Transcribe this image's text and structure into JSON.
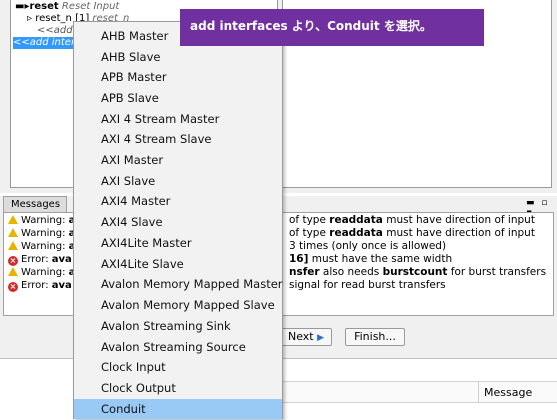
{
  "tree": {
    "rows": [
      {
        "name": "reset",
        "type": "Reset Input"
      },
      {
        "name": "reset_n [1]",
        "type": "reset_n"
      },
      {
        "label": "<<add s"
      },
      {
        "label": "<<add inter"
      }
    ]
  },
  "messages": {
    "tab_label": "Messages",
    "controls": "▬ ▫ ▪",
    "rows": [
      {
        "level": "warning",
        "level_label": "Warning:",
        "prefix": "av",
        "text_before": "of type ",
        "keyword": "readdata",
        "text_after": " must have direction of input"
      },
      {
        "level": "warning",
        "level_label": "Warning:",
        "prefix": "a",
        "text_before": "of type ",
        "keyword": "readdata",
        "text_after": " must have direction of input"
      },
      {
        "level": "warning",
        "level_label": "Warning:",
        "prefix": "a",
        "text_before": "3 times (only once is allowed)",
        "keyword": "",
        "text_after": ""
      },
      {
        "level": "error",
        "level_label": "Error:",
        "prefix": "ava",
        "text_before": "",
        "keyword": "16]",
        "text_after": " must have the same width"
      },
      {
        "level": "warning",
        "level_label": "Warning:",
        "prefix": "a",
        "text_before": "",
        "keyword": "nsfer",
        "text_after": " also needs ",
        "keyword2": "burstcount",
        "text_after2": " for burst transfers"
      },
      {
        "level": "error",
        "level_label": "Error:",
        "prefix": "ava",
        "text_before": "signal for read burst transfers",
        "keyword": "",
        "text_after": ""
      }
    ]
  },
  "wizard": {
    "next_label": "Next",
    "next_icon": "triangle-right-icon",
    "finish_label": "Finish..."
  },
  "bottom_table": {
    "message_column": "Message"
  },
  "menu": {
    "items": [
      "AHB Master",
      "AHB Slave",
      "APB Master",
      "APB Slave",
      "AXI 4 Stream Master",
      "AXI 4 Stream Slave",
      "AXI Master",
      "AXI Slave",
      "AXI4 Master",
      "AXI4 Slave",
      "AXI4Lite Master",
      "AXI4Lite Slave",
      "Avalon Memory Mapped Master",
      "Avalon Memory Mapped Slave",
      "Avalon Streaming Sink",
      "Avalon Streaming Source",
      "Clock Input",
      "Clock Output",
      "Conduit"
    ],
    "highlighted": "Conduit"
  },
  "annotation": {
    "text": "add interfaces より、Conduit を選択。"
  },
  "colors": {
    "annotation_bg": "#7030a0",
    "menu_highlight": "#99c9f5",
    "selection": "#3399ff",
    "warning": "#e8b400",
    "error": "#d42a2a"
  }
}
